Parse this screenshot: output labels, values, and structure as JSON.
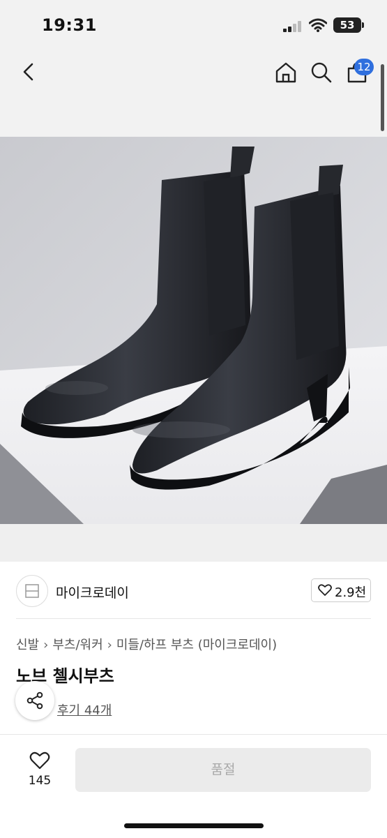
{
  "status_bar": {
    "time": "19:31",
    "battery": "53"
  },
  "header": {
    "back_icon": "chevron-left-icon",
    "home_icon": "home-icon",
    "search_icon": "search-icon",
    "cart_icon": "shopping-bag-icon",
    "cart_count": "12"
  },
  "product_image": {
    "subject": "black leather chelsea boots"
  },
  "brand": {
    "name": "마이크로데이",
    "likes": "2.9천"
  },
  "breadcrumb": [
    "신발",
    "부츠/워커",
    "미들/하프 부츠 (마이크로데이)"
  ],
  "product": {
    "title": "노브 첼시부츠",
    "reviews": "후기 44개"
  },
  "bottom_bar": {
    "wish_count": "145",
    "action_label": "품절"
  },
  "colors": {
    "accent": "#2f6fde",
    "disabled_bg": "#ebebeb",
    "disabled_text": "#a8a8a8"
  }
}
